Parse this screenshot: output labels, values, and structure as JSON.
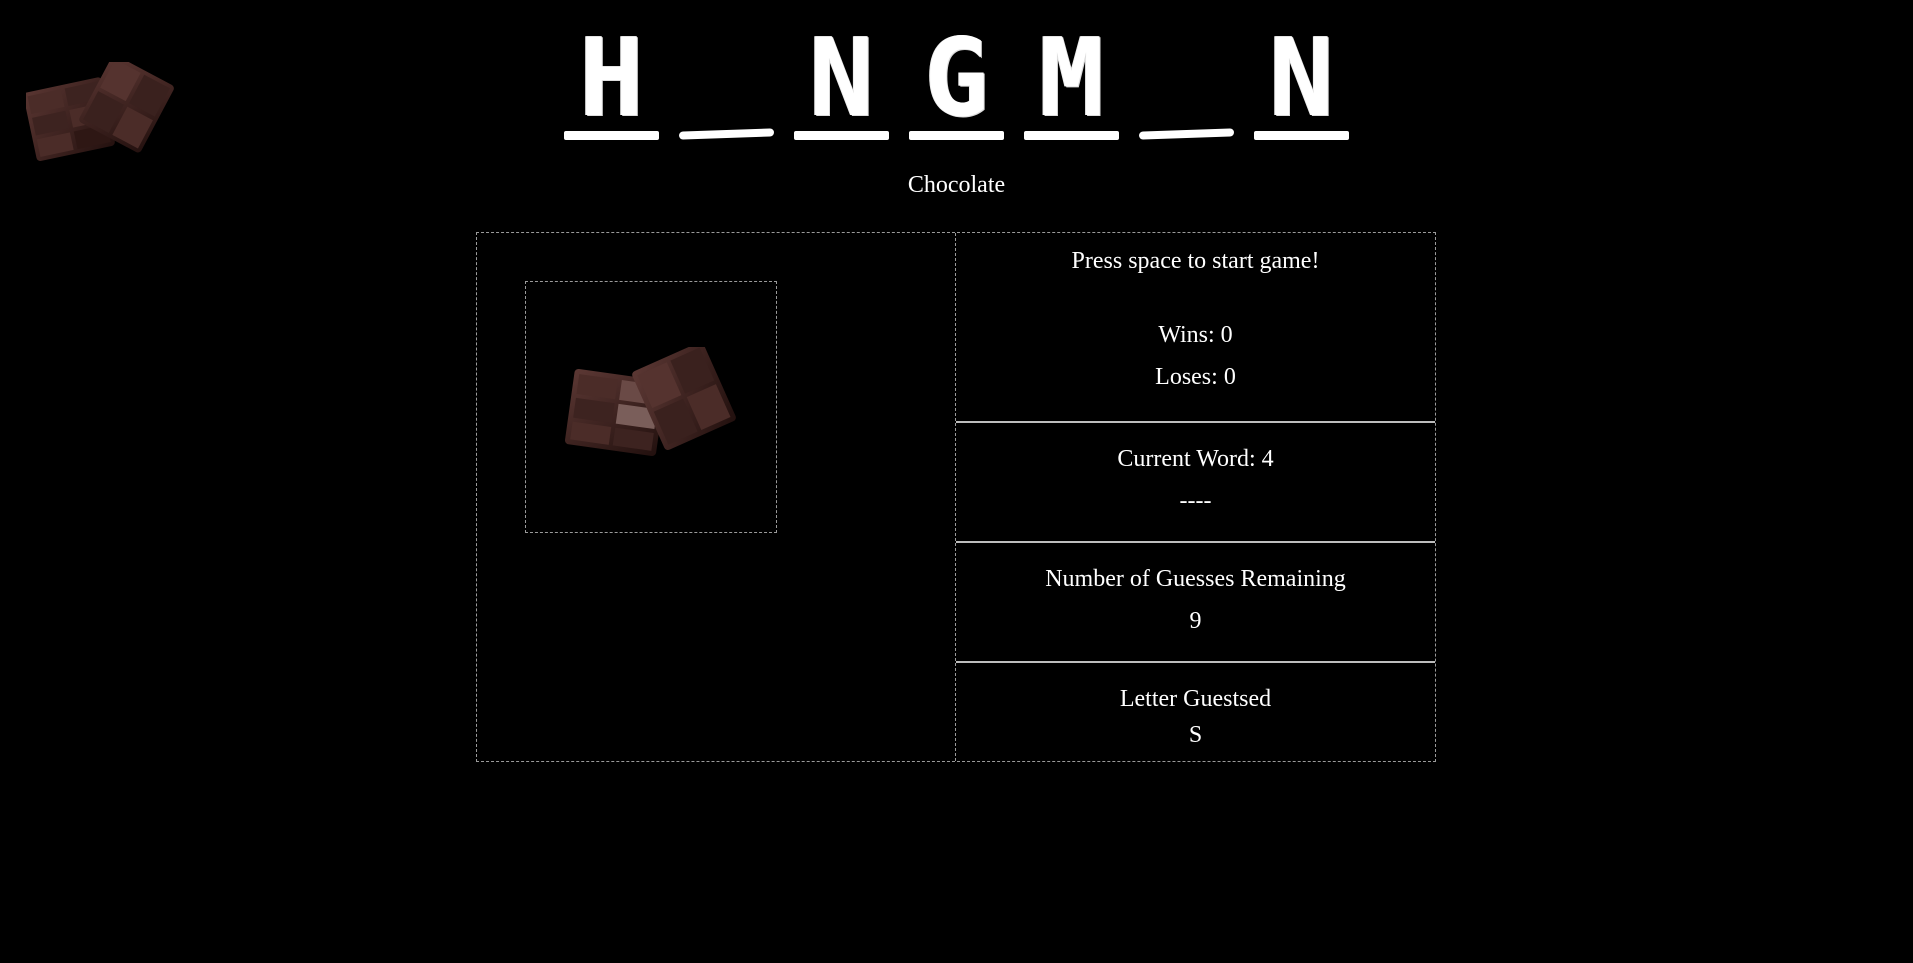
{
  "title": {
    "letters": [
      "H",
      "_",
      "N",
      "G",
      "M",
      "_",
      "N"
    ]
  },
  "subtitle": "Chocolate",
  "status": {
    "start_message": "Press space to start game!",
    "wins_label": "Wins: 0",
    "loses_label": "Loses: 0"
  },
  "word": {
    "label": "Current Word: 4",
    "blanks": "----"
  },
  "guesses": {
    "label": "Number of Guesses Remaining",
    "value": "9"
  },
  "letters": {
    "label": "Letter Guestsed",
    "value": "S"
  },
  "icons": {
    "corner": "chocolate-bar-icon",
    "main": "chocolate-bar-icon"
  },
  "colors": {
    "background": "#000000",
    "text": "#ffffff",
    "border": "#9a9a9a",
    "chocolate_dark": "#2a1714",
    "chocolate_light": "#4a2a26"
  }
}
